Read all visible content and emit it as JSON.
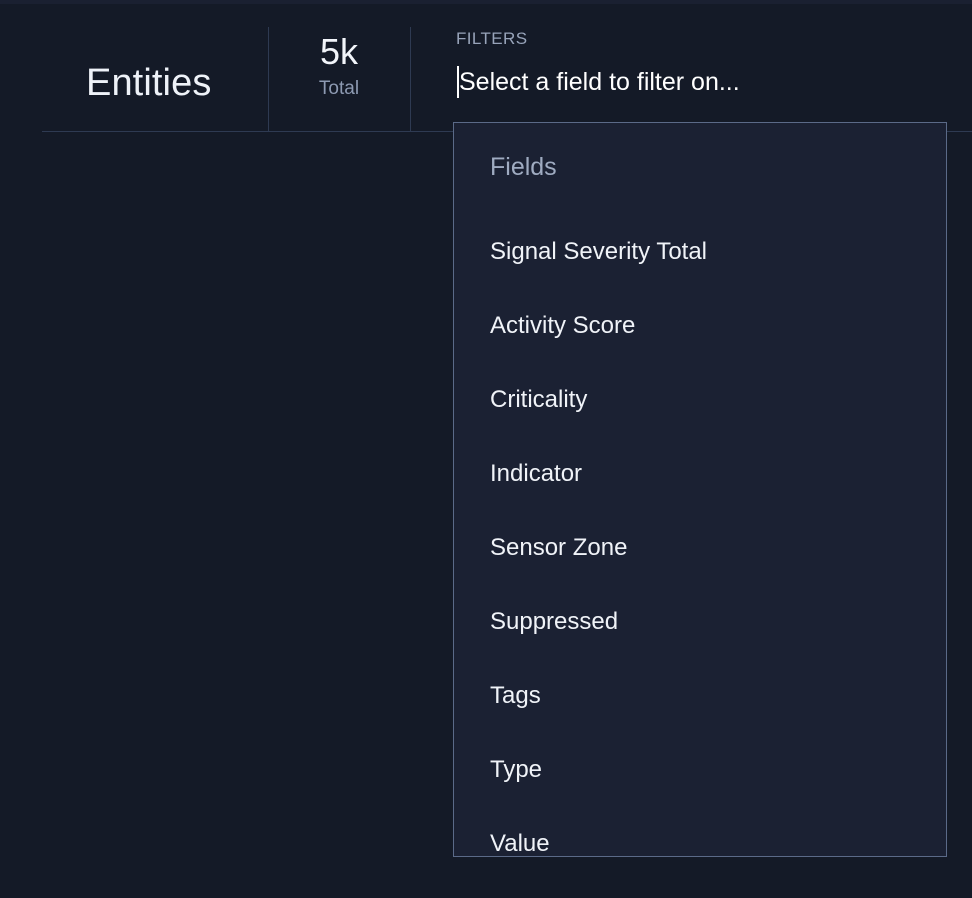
{
  "header": {
    "page_title": "Entities",
    "stat": {
      "value": "5k",
      "label": "Total"
    }
  },
  "filters": {
    "label": "FILTERS",
    "input_value": "",
    "placeholder": "Select a field to filter on..."
  },
  "dropdown": {
    "heading": "Fields",
    "fields": [
      {
        "label": "Signal Severity Total"
      },
      {
        "label": "Activity Score"
      },
      {
        "label": "Criticality"
      },
      {
        "label": "Indicator"
      },
      {
        "label": "Sensor Zone"
      },
      {
        "label": "Suppressed"
      },
      {
        "label": "Tags"
      },
      {
        "label": "Type"
      },
      {
        "label": "Value"
      }
    ]
  },
  "colors": {
    "page_background": "#141a27",
    "panel_background": "#1b2133",
    "panel_border": "#5b6a88",
    "divider": "#2e3a52",
    "text_primary": "#f0f3f8",
    "text_muted": "#98a4ba",
    "caret": "#ffffff"
  }
}
